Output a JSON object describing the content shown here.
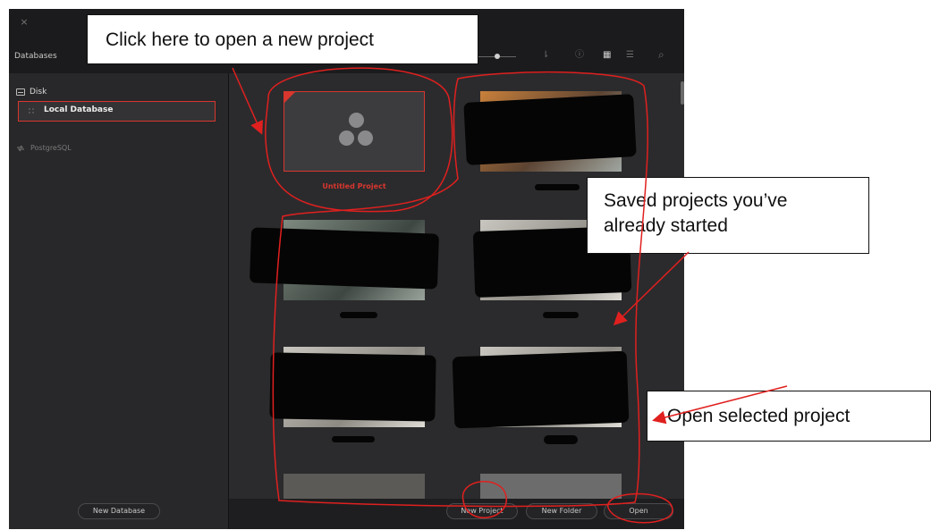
{
  "window": {
    "close_glyph": "×"
  },
  "sidebar": {
    "title": "Databases",
    "disk_label": "Disk",
    "local_database_label": "Local Database",
    "postgres_label": "PostgreSQL",
    "new_database_label": "New Database"
  },
  "toolbar": {
    "icons": [
      "sort-icon",
      "info-icon",
      "grid-view-icon",
      "list-view-icon",
      "search-icon"
    ],
    "sort_glyph": "⇂",
    "info_glyph": "ⓘ",
    "grid_glyph": "▦",
    "list_glyph": "☰",
    "search_glyph": "⌕"
  },
  "projects": {
    "new_project_tile_label": "Untitled Project"
  },
  "bottom_bar": {
    "new_project_label": "New Project",
    "new_folder_label": "New Folder",
    "open_label": "Open"
  },
  "annotations": {
    "callout_new_project": "Click here to open a new project",
    "callout_saved_line1": "Saved projects you’ve",
    "callout_saved_line2": "already started",
    "callout_open": "Open selected project"
  },
  "colors": {
    "accent_red": "#d8362e",
    "annotation_red": "#e0201f",
    "background": "#1f1f21"
  }
}
